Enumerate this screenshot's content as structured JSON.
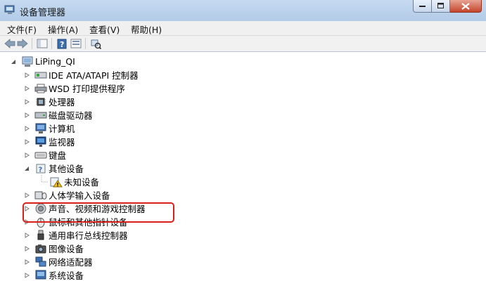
{
  "window": {
    "title": "设备管理器"
  },
  "menu": {
    "items": [
      "文件(F)",
      "操作(A)",
      "查看(V)",
      "帮助(H)"
    ]
  },
  "tree": {
    "root": "LiPing_QI",
    "items": [
      {
        "label": "IDE ATA/ATAPI 控制器"
      },
      {
        "label": "WSD 打印提供程序"
      },
      {
        "label": "处理器"
      },
      {
        "label": "磁盘驱动器"
      },
      {
        "label": "计算机"
      },
      {
        "label": "监视器"
      },
      {
        "label": "键盘"
      },
      {
        "label": "其他设备"
      },
      {
        "label": "未知设备"
      },
      {
        "label": "人体学输入设备"
      },
      {
        "label": "声音、视频和游戏控制器"
      },
      {
        "label": "鼠标和其他指针设备"
      },
      {
        "label": "通用串行总线控制器"
      },
      {
        "label": "图像设备"
      },
      {
        "label": "网络适配器"
      },
      {
        "label": "系统设备"
      }
    ]
  },
  "colors": {
    "highlight": "#d9211c",
    "accent": "#3c7fb1"
  }
}
